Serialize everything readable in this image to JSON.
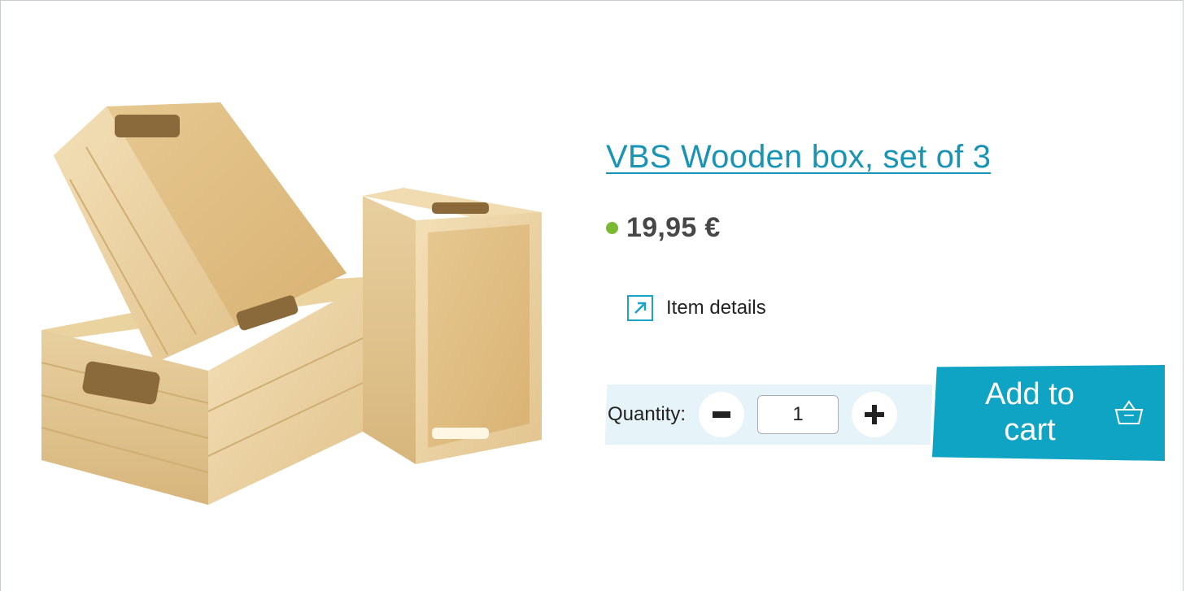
{
  "product": {
    "title": "VBS Wooden box, set of 3",
    "price": "19,95 €",
    "image_alt": "wooden-boxes-image"
  },
  "details": {
    "label": "Item details",
    "icon": "external-arrow-icon"
  },
  "quantity": {
    "label": "Quantity:",
    "value": "1",
    "minus_icon": "minus-icon",
    "plus_icon": "plus-icon"
  },
  "cart": {
    "label_line1": "Add to",
    "label_line2": "cart",
    "icon": "basket-icon"
  },
  "colors": {
    "accent": "#1a94b4",
    "cart_bg": "#0fa3c4",
    "stock": "#7ab932",
    "qty_strip": "#e6f3f8"
  }
}
